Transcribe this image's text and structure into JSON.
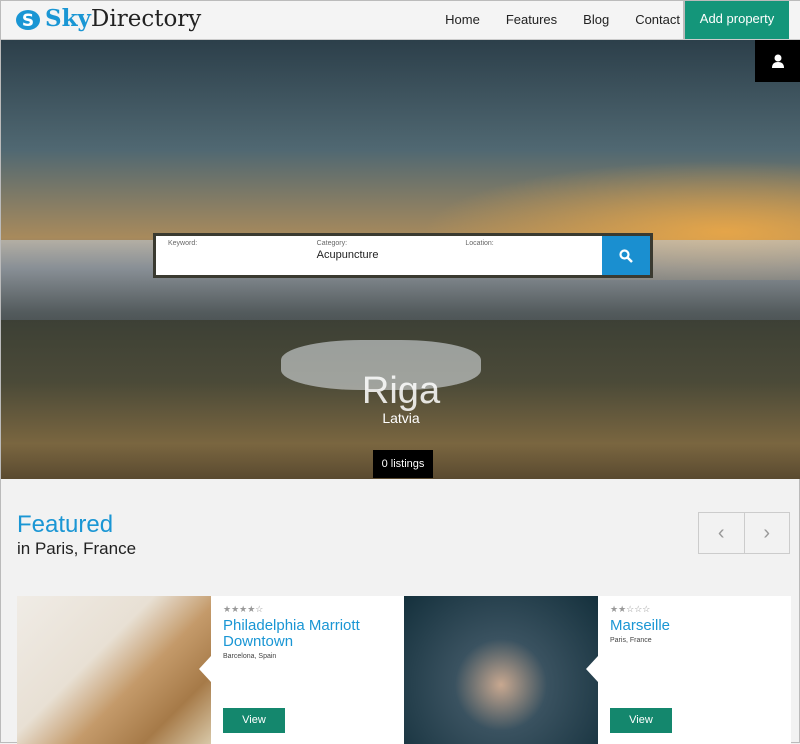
{
  "header": {
    "logo_bold": "Sky",
    "logo_rest": "Directory",
    "nav": [
      "Home",
      "Features",
      "Blog",
      "Contact"
    ],
    "add_property": "Add property"
  },
  "search": {
    "keyword_label": "Keyword:",
    "keyword_value": "",
    "category_label": "Category:",
    "category_value": "Acupuncture",
    "location_label": "Location:",
    "location_value": ""
  },
  "hero": {
    "city": "Riga",
    "country": "Latvia",
    "listings": "0 listings"
  },
  "featured": {
    "title": "Featured",
    "subtitle": "in Paris, France",
    "prev": "‹",
    "next": "›"
  },
  "cards": [
    {
      "title": "Philadelphia Marriott Downtown",
      "location": "Barcelona, Spain",
      "rating": 4,
      "max_rating": 5,
      "stars": "★★★★☆",
      "button": "View"
    },
    {
      "title": "Marseille",
      "location": "Paris, France",
      "rating": 2,
      "max_rating": 5,
      "stars": "★★☆☆☆",
      "button": "View"
    }
  ],
  "colors": {
    "accent": "#1a96d4",
    "green": "#14967a"
  }
}
